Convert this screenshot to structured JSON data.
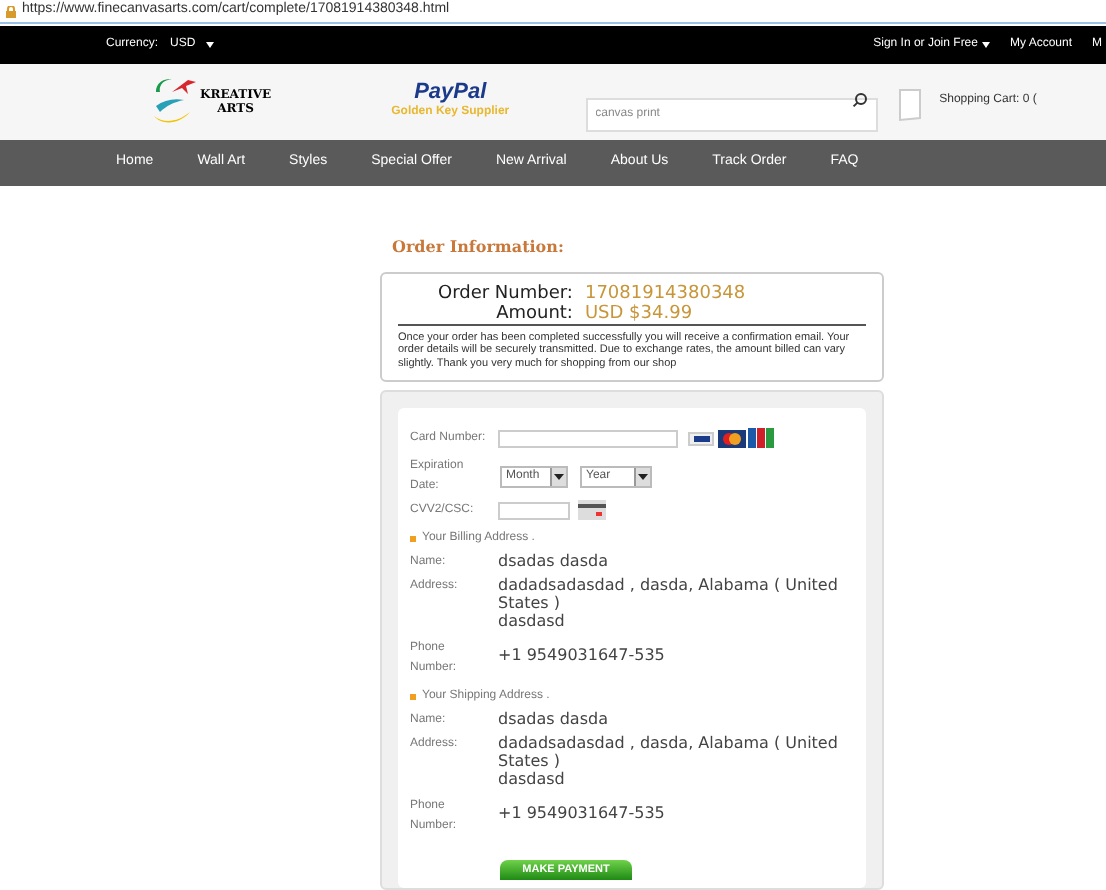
{
  "address_bar": {
    "url": "https://www.finecanvasarts.com/cart/complete/17081914380348.html"
  },
  "top_bar": {
    "currency_label": "Currency:",
    "currency": "USD",
    "sign_in": "Sign In or Join Free",
    "my_account": "My Account",
    "cut_item": "M"
  },
  "header": {
    "logo_text": [
      "KREATIVE",
      "ARTS"
    ],
    "paypal": "PayPal",
    "paypal_badge": "Golden Key Supplier",
    "search": {
      "value": "canvas print"
    },
    "cart": "Shopping Cart: 0 ("
  },
  "nav": [
    "Home",
    "Wall Art",
    "Styles",
    "Special Offer",
    "New Arrival",
    "About Us",
    "Track Order",
    "FAQ"
  ],
  "order": {
    "title": "Order Information:",
    "number_label": "Order Number:",
    "number": "17081914380348",
    "amount_label": "Amount:",
    "amount": "USD $34.99",
    "note": "Once your order has been completed successfully you will receive a confirmation email. Your order details will be securely transmitted. Due to exchange rates, the amount billed can vary slightly. Thank you very much for shopping from our shop"
  },
  "payment": {
    "card_label": "Card Number:",
    "expiration_label": "Expiration Date:",
    "month": "Month",
    "year": "Year",
    "cvv_label": "CVV2/CSC:",
    "addresses": [
      {
        "heading": "Your Billing Address .",
        "name_label": "Name:",
        "name": "dsadas dasda",
        "address_label": "Address:",
        "address": [
          "dadadsadasdad , dasda, Alabama ( United States )",
          "dasdasd"
        ],
        "phone_label": "Phone Number:",
        "phone": "+1 9549031647-535"
      },
      {
        "heading": "Your Shipping Address .",
        "name_label": "Name:",
        "name": "dsadas dasda",
        "address_label": "Address:",
        "address": [
          "dadadsadasdad , dasda, Alabama ( United States )",
          "dasdasd"
        ],
        "phone_label": "Phone Number:",
        "phone": "+1 9549031647-535"
      }
    ],
    "button": "MAKE PAYMENT"
  }
}
